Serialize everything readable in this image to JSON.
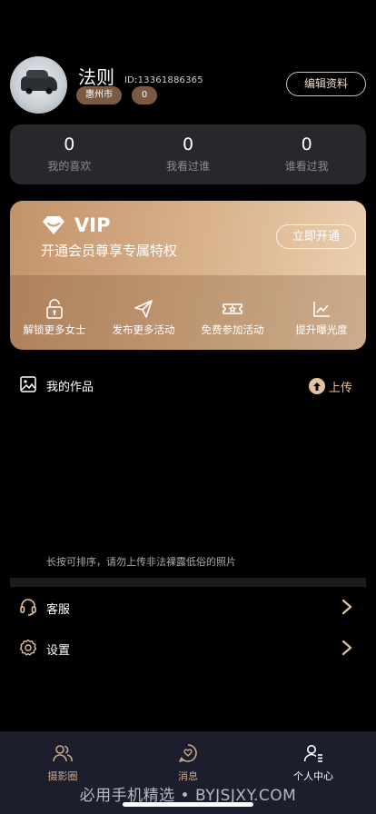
{
  "profile": {
    "name": "法则",
    "id_text": "ID:13361886365",
    "city": "惠州市",
    "count": "0",
    "edit_label": "编辑资料"
  },
  "stats": [
    {
      "value": "0",
      "label": "我的喜欢"
    },
    {
      "value": "0",
      "label": "我看过谁"
    },
    {
      "value": "0",
      "label": "谁看过我"
    }
  ],
  "vip": {
    "title": "VIP",
    "subtitle": "开通会员尊享专属特权",
    "button_label": "立即开通",
    "perks": [
      {
        "icon": "unlock-icon",
        "label": "解锁更多女士"
      },
      {
        "icon": "send-icon",
        "label": "发布更多活动"
      },
      {
        "icon": "ticket-icon",
        "label": "免费参加活动"
      },
      {
        "icon": "chart-icon",
        "label": "提升曝光度"
      }
    ]
  },
  "works": {
    "title": "我的作品",
    "upload_label": "上传",
    "hint": "长按可排序，请勿上传非法裸露低俗的照片"
  },
  "menu": [
    {
      "icon": "headset-icon",
      "label": "客服"
    },
    {
      "icon": "settings-icon",
      "label": "设置"
    }
  ],
  "tabs": [
    {
      "icon": "community-icon",
      "label": "摄影圈",
      "active": false
    },
    {
      "icon": "message-icon",
      "label": "消息",
      "active": false
    },
    {
      "icon": "profile-icon",
      "label": "个人中心",
      "active": true
    }
  ],
  "footer_watermark": "必用手机精选 • BYJSJXY.COM",
  "colors": {
    "background": "#000000",
    "card": "#28272c",
    "accent_gold": "#e3c39d",
    "tag_brown": "#7a5a42",
    "tabbar": "#1c1d2d",
    "tab_inactive": "#c9a98a",
    "tab_active": "#ffffff"
  }
}
